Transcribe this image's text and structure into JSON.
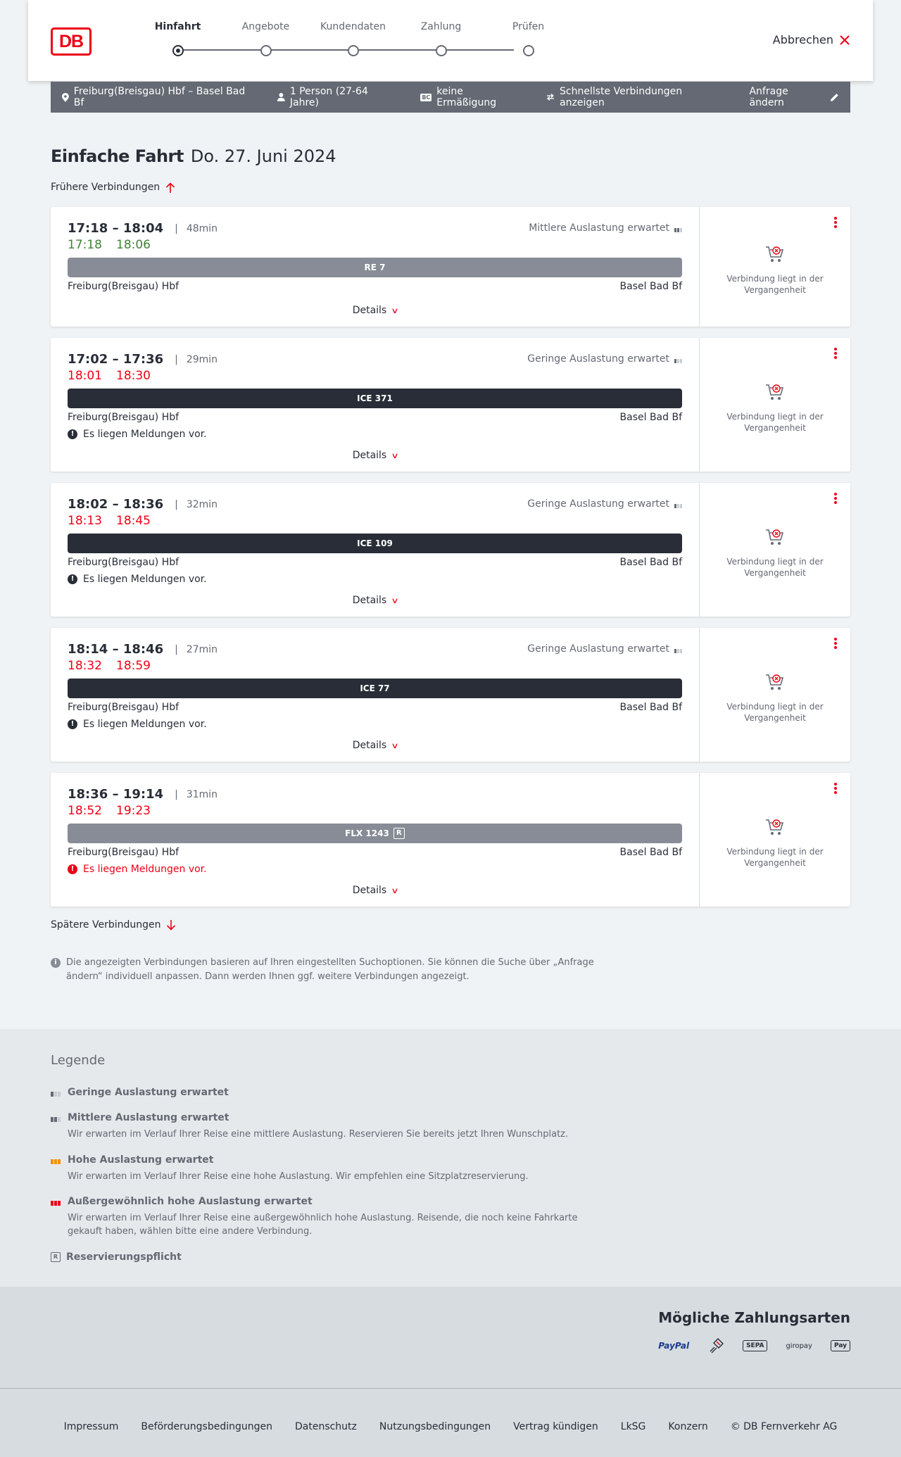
{
  "header": {
    "logo_text": "DB",
    "steps": [
      {
        "label": "Hinfahrt",
        "active": true
      },
      {
        "label": "Angebote",
        "active": false
      },
      {
        "label": "Kundendaten",
        "active": false
      },
      {
        "label": "Zahlung",
        "active": false
      },
      {
        "label": "Prüfen",
        "active": false
      }
    ],
    "cancel_label": "Abbrechen"
  },
  "query": {
    "route": "Freiburg(Breisgau) Hbf – Basel Bad Bf",
    "persons": "1 Person (27-64 Jahre)",
    "discount_badge": "BC",
    "discount": "keine Ermäßigung",
    "fastest": "Schnellste Verbindungen anzeigen",
    "edit": "Anfrage ändern"
  },
  "title": {
    "type": "Einfache Fahrt",
    "date": "Do. 27. Juni 2024"
  },
  "earlier": "Frühere Verbindungen",
  "later": "Spätere Verbindungen",
  "connections": [
    {
      "times": "17:18 – 18:04",
      "duration": "48min",
      "rt_dep": "17:18",
      "rt_arr": "18:06",
      "rt_status": "ok",
      "occupancy": "Mittlere Auslastung erwartet",
      "occupancy_level": 2,
      "train": "RE 7",
      "train_style": "grey",
      "reservation_required": false,
      "from": "Freiburg(Breisgau) Hbf",
      "to": "Basel Bad Bf",
      "message": "",
      "details": "Details",
      "side_text": "Verbindung liegt in der Vergangenheit"
    },
    {
      "times": "17:02 – 17:36",
      "duration": "29min",
      "rt_dep": "18:01",
      "rt_arr": "18:30",
      "rt_status": "late",
      "occupancy": "Geringe Auslastung erwartet",
      "occupancy_level": 1,
      "train": "ICE 371",
      "train_style": "dark",
      "reservation_required": false,
      "from": "Freiburg(Breisgau) Hbf",
      "to": "Basel Bad Bf",
      "message": "Es liegen Meldungen vor.",
      "message_style": "normal",
      "details": "Details",
      "side_text": "Verbindung liegt in der Vergangenheit"
    },
    {
      "times": "18:02 – 18:36",
      "duration": "32min",
      "rt_dep": "18:13",
      "rt_arr": "18:45",
      "rt_status": "late",
      "occupancy": "Geringe Auslastung erwartet",
      "occupancy_level": 1,
      "train": "ICE 109",
      "train_style": "dark",
      "reservation_required": false,
      "from": "Freiburg(Breisgau) Hbf",
      "to": "Basel Bad Bf",
      "message": "Es liegen Meldungen vor.",
      "message_style": "normal",
      "details": "Details",
      "side_text": "Verbindung liegt in der Vergangenheit"
    },
    {
      "times": "18:14 – 18:46",
      "duration": "27min",
      "rt_dep": "18:32",
      "rt_arr": "18:59",
      "rt_status": "late",
      "occupancy": "Geringe Auslastung erwartet",
      "occupancy_level": 1,
      "train": "ICE 77",
      "train_style": "dark",
      "reservation_required": false,
      "from": "Freiburg(Breisgau) Hbf",
      "to": "Basel Bad Bf",
      "message": "Es liegen Meldungen vor.",
      "message_style": "normal",
      "details": "Details",
      "side_text": "Verbindung liegt in der Vergangenheit"
    },
    {
      "times": "18:36 – 19:14",
      "duration": "31min",
      "rt_dep": "18:52",
      "rt_arr": "19:23",
      "rt_status": "late",
      "occupancy": "",
      "occupancy_level": 0,
      "train": "FLX 1243",
      "train_style": "grey",
      "reservation_required": true,
      "reservation_badge": "R",
      "from": "Freiburg(Breisgau) Hbf",
      "to": "Basel Bad Bf",
      "message": "Es liegen Meldungen vor.",
      "message_style": "red",
      "details": "Details",
      "side_text": "Verbindung liegt in der Vergangenheit"
    }
  ],
  "note": "Die angezeigten Verbindungen basieren auf Ihren eingestellten Suchoptionen. Sie können die Suche über „Anfrage ändern“ individuell anpassen. Dann werden Ihnen ggf. weitere Verbindungen angezeigt.",
  "legend": {
    "title": "Legende",
    "items": [
      {
        "label": "Geringe Auslastung erwartet",
        "text": ""
      },
      {
        "label": "Mittlere Auslastung erwartet",
        "text": "Wir erwarten im Verlauf Ihrer Reise eine mittlere Auslastung. Reservieren Sie bereits jetzt Ihren Wunschplatz."
      },
      {
        "label": "Hohe Auslastung erwartet",
        "text": "Wir erwarten im Verlauf Ihrer Reise eine hohe Auslastung. Wir empfehlen eine Sitzplatzreservierung."
      },
      {
        "label": "Außergewöhnlich hohe Auslastung erwartet",
        "text": "Wir erwarten im Verlauf Ihrer Reise eine außergewöhnlich hohe Auslastung. Reisende, die noch keine Fahrkarte gekauft haben, wählen bitte eine andere Verbindung."
      },
      {
        "label": "Reservierungspflicht",
        "text": "",
        "badge": "R"
      }
    ]
  },
  "payment": {
    "title": "Mögliche Zahlungsarten",
    "methods": [
      "PayPal",
      "SEPA",
      "giropay",
      "Pay"
    ]
  },
  "footer": {
    "links": [
      "Impressum",
      "Beförderungsbedingungen",
      "Datenschutz",
      "Nutzungsbedingungen",
      "Vertrag kündigen",
      "LkSG",
      "Konzern"
    ],
    "copyright": "© DB Fernverkehr AG"
  },
  "colors": {
    "db_red": "#ec0016",
    "on_time": "#408335",
    "delay": "#ec0016",
    "dark_train": "#282d37",
    "grey_train": "#878c96",
    "query_bar": "#646973"
  }
}
